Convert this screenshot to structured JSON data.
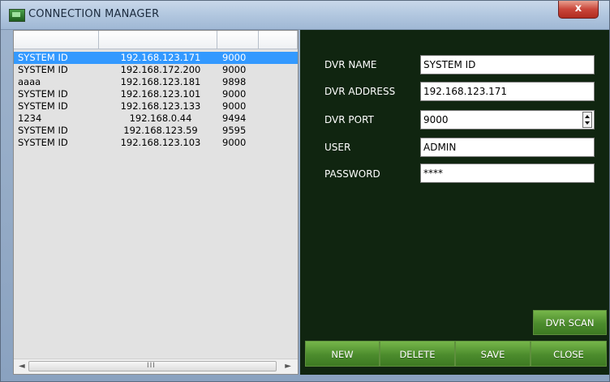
{
  "window": {
    "title": "CONNECTION MANAGER",
    "close_label": "x"
  },
  "list": {
    "columns": [
      "",
      "",
      "",
      ""
    ],
    "rows": [
      {
        "name": "SYSTEM ID",
        "ip": "192.168.123.171",
        "port": "9000",
        "selected": true
      },
      {
        "name": "SYSTEM ID",
        "ip": "192.168.172.200",
        "port": "9000"
      },
      {
        "name": "aaaa",
        "ip": "192.168.123.181",
        "port": "9898"
      },
      {
        "name": "SYSTEM ID",
        "ip": "192.168.123.101",
        "port": "9000"
      },
      {
        "name": "SYSTEM ID",
        "ip": "192.168.123.133",
        "port": "9000"
      },
      {
        "name": "1234",
        "ip": "192.168.0.44",
        "port": "9494"
      },
      {
        "name": "SYSTEM ID",
        "ip": "192.168.123.59",
        "port": "9595"
      },
      {
        "name": "SYSTEM ID",
        "ip": "192.168.123.103",
        "port": "9000"
      }
    ],
    "scrollbar": {
      "left_arrow": "◄",
      "right_arrow": "►",
      "grip": "III"
    }
  },
  "form": {
    "dvr_name_label": "DVR NAME",
    "dvr_name_value": "SYSTEM ID",
    "dvr_address_label": "DVR ADDRESS",
    "dvr_address_value": "192.168.123.171",
    "dvr_port_label": "DVR PORT",
    "dvr_port_value": "9000",
    "user_label": "USER",
    "user_value": "ADMIN",
    "password_label": "PASSWORD",
    "password_value": "****"
  },
  "buttons": {
    "dvr_scan": "DVR SCAN",
    "new": "NEW",
    "delete": "DELETE",
    "save": "SAVE",
    "close": "CLOSE"
  },
  "colors": {
    "selection": "#3399ff",
    "panel_background": "#102510",
    "button_green": "#4c8c2d"
  }
}
